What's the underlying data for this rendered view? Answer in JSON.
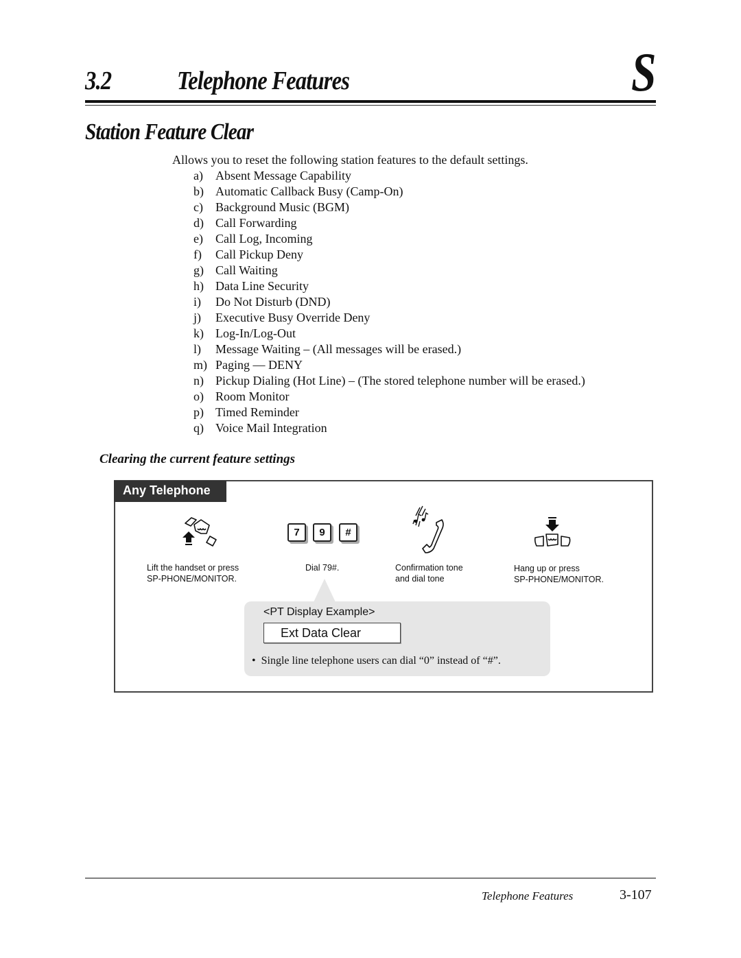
{
  "header": {
    "section_number": "3.2",
    "section_title": "Telephone Features",
    "chapter_letter": "S"
  },
  "feature": {
    "title": "Station Feature Clear",
    "intro": "Allows you to reset the following station features to the default settings.",
    "items": [
      {
        "letter": "a)",
        "text": "Absent Message Capability"
      },
      {
        "letter": "b)",
        "text": "Automatic Callback Busy (Camp-On)"
      },
      {
        "letter": "c)",
        "text": "Background Music (BGM)"
      },
      {
        "letter": "d)",
        "text": "Call Forwarding"
      },
      {
        "letter": "e)",
        "text": "Call Log, Incoming"
      },
      {
        "letter": "f)",
        "text": "Call Pickup Deny"
      },
      {
        "letter": "g)",
        "text": "Call Waiting"
      },
      {
        "letter": "h)",
        "text": "Data Line Security"
      },
      {
        "letter": "i)",
        "text": "Do Not Disturb (DND)"
      },
      {
        "letter": "j)",
        "text": "Executive Busy Override Deny"
      },
      {
        "letter": "k)",
        "text": "Log-In/Log-Out"
      },
      {
        "letter": "l)",
        "text": "Message Waiting – (All messages will be erased.)"
      },
      {
        "letter": "m)",
        "text": "Paging — DENY"
      },
      {
        "letter": "n)",
        "text": "Pickup Dialing (Hot Line) – (The stored telephone number will be erased.)"
      },
      {
        "letter": "o)",
        "text": "Room Monitor"
      },
      {
        "letter": "p)",
        "text": "Timed Reminder"
      },
      {
        "letter": "q)",
        "text": "Voice Mail Integration"
      }
    ]
  },
  "procedure": {
    "subtitle": "Clearing the current feature settings",
    "tab_label": "Any Telephone",
    "steps": [
      {
        "icon": "off-hook-icon",
        "caption_line1": "Lift the handset or press",
        "caption_line2": "SP-PHONE/MONITOR."
      },
      {
        "icon": "keypad-keys",
        "keys": [
          "7",
          "9",
          "#"
        ],
        "caption_line1": "Dial 79#.",
        "caption_line2": ""
      },
      {
        "icon": "confirmation-tone-icon",
        "caption_line1": "Confirmation tone",
        "caption_line2": "and dial tone"
      },
      {
        "icon": "on-hook-icon",
        "caption_line1": "Hang up or press",
        "caption_line2": "SP-PHONE/MONITOR."
      }
    ],
    "display_example": {
      "label": "<PT Display Example>",
      "screen_text": "Ext Data Clear",
      "note": "Single line telephone users can dial “0” instead of “#”."
    }
  },
  "footer": {
    "section_title": "Telephone Features",
    "page_number": "3-107"
  }
}
